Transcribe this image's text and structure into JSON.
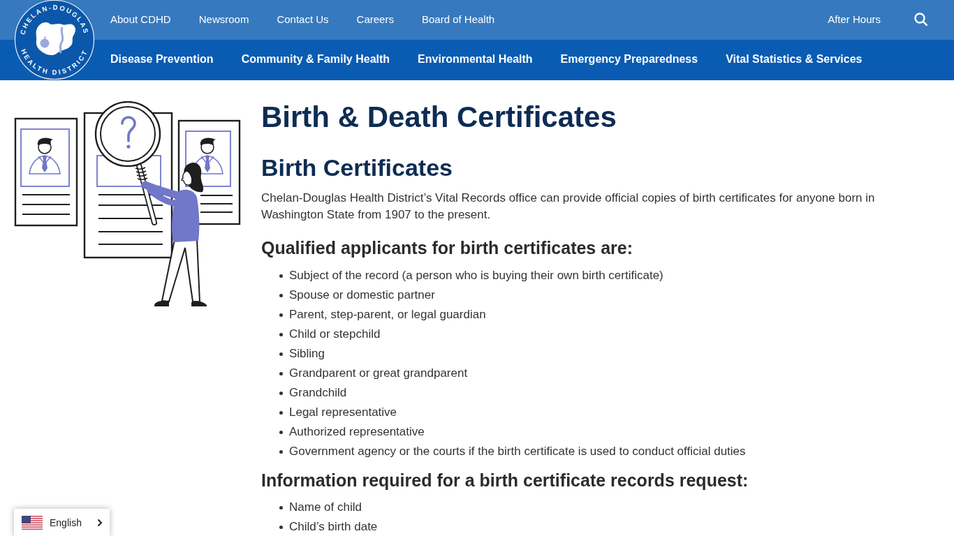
{
  "logo": {
    "top_text": "CHELAN-DOUGLAS",
    "bottom_text": "HEALTH DISTRICT"
  },
  "utility_nav": {
    "links": [
      "About CDHD",
      "Newsroom",
      "Contact Us",
      "Careers",
      "Board of Health"
    ],
    "after_hours": "After Hours"
  },
  "main_nav": {
    "items": [
      "Disease Prevention",
      "Community & Family Health",
      "Environmental Health",
      "Emergency Preparedness",
      "Vital Statistics & Services"
    ]
  },
  "page": {
    "title": "Birth & Death Certificates",
    "sections": [
      {
        "heading": "Birth Certificates",
        "intro": "Chelan-Douglas Health District’s Vital Records office can provide official copies of birth certificates for anyone born in Washington State from 1907 to the present.",
        "lists": [
          {
            "heading": "Qualified applicants for birth certificates are:",
            "items": [
              "Subject of the record (a person who is buying their own birth certificate)",
              "Spouse or domestic partner",
              "Parent, step-parent, or legal guardian",
              "Child or stepchild",
              "Sibling",
              "Grandparent or great grandparent",
              "Grandchild",
              "Legal representative",
              "Authorized representative",
              "Government agency or the courts if the birth certificate is used to conduct official duties"
            ]
          },
          {
            "heading": "Information required for a birth certificate records request:",
            "items": [
              "Name of child",
              "Child’s birth date"
            ]
          }
        ]
      }
    ]
  },
  "language_selector": {
    "label": "English"
  }
}
